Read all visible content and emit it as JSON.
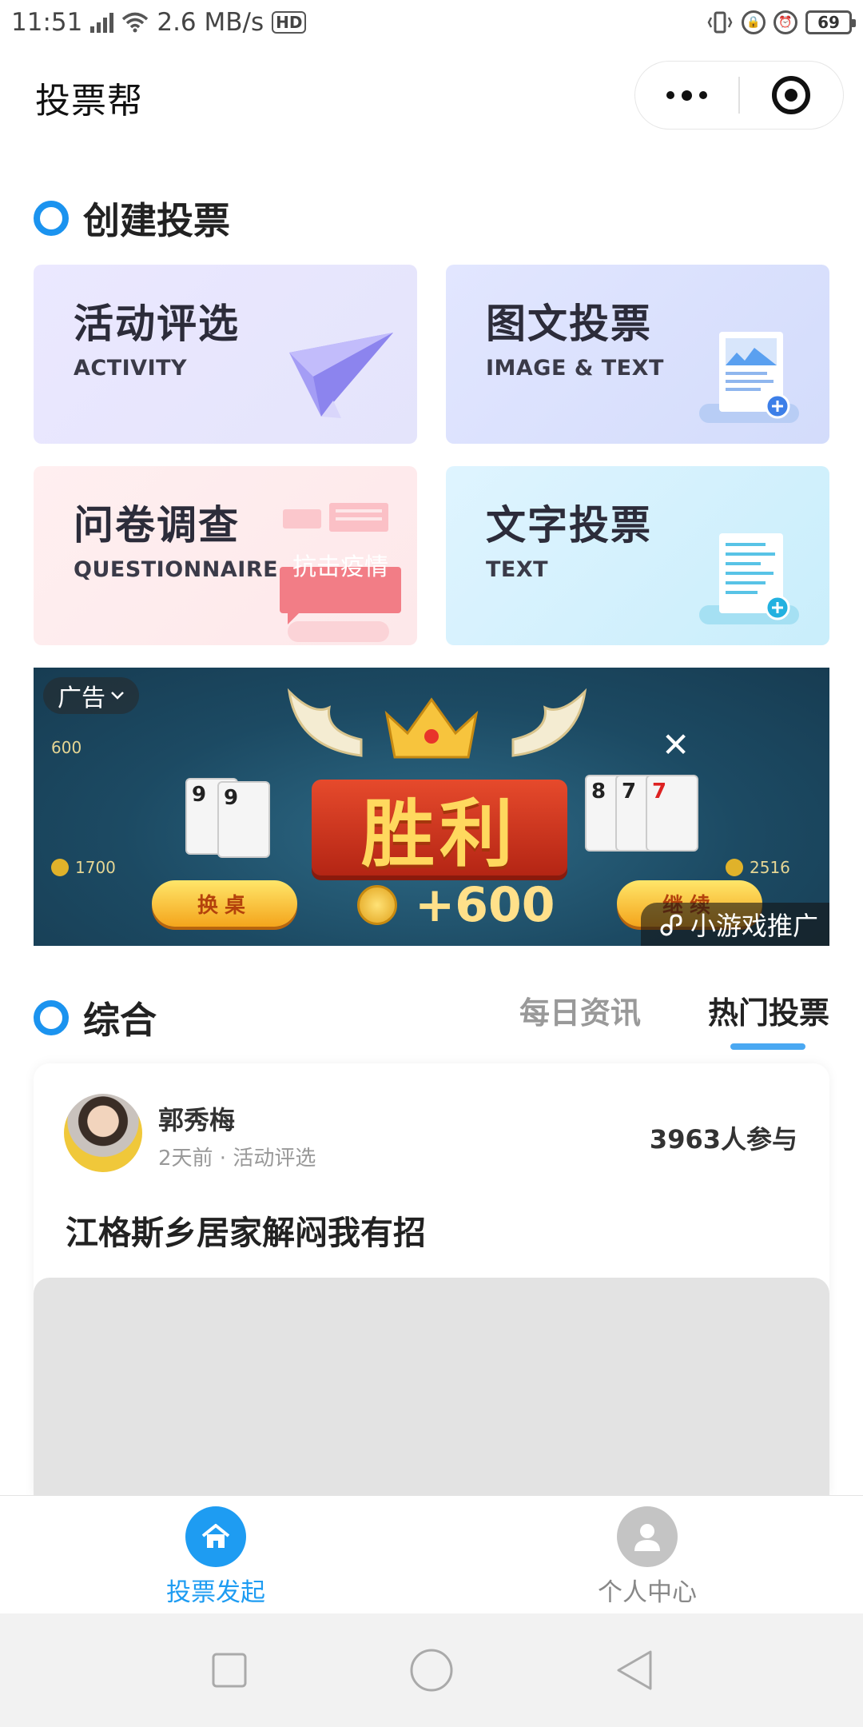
{
  "status_bar": {
    "time": "11:51",
    "network": "4G",
    "speed": "2.6 MB/s",
    "hd": "HD",
    "battery": "69"
  },
  "header": {
    "title": "投票帮",
    "more_icon": "more-dots-icon",
    "close_icon": "target-close-icon"
  },
  "create_section": {
    "title": "创建投票",
    "cards": [
      {
        "title": "活动评选",
        "subtitle": "ACTIVITY",
        "icon": "paper-plane-icon"
      },
      {
        "title": "图文投票",
        "subtitle": "IMAGE & TEXT",
        "icon": "image-document-icon"
      },
      {
        "title": "问卷调查",
        "subtitle": "QUESTIONNAIRE",
        "icon": "chat-bubble-icon",
        "badge": "抗击疫情"
      },
      {
        "title": "文字投票",
        "subtitle": "TEXT",
        "icon": "text-document-icon"
      }
    ]
  },
  "ad": {
    "tag": "广告",
    "banner_title": "胜利",
    "reward": "+600",
    "left_button": "换桌",
    "right_button": "继续",
    "promo_label": "小游戏推广",
    "score_left": "1700",
    "score_right": "2516",
    "score_top": "600"
  },
  "feed_section": {
    "title": "综合",
    "tabs": [
      {
        "label": "每日资讯",
        "active": false
      },
      {
        "label": "热门投票",
        "active": true
      }
    ]
  },
  "vote_item": {
    "author": "郭秀梅",
    "meta": "2天前 · 活动评选",
    "participants": "3963人参与",
    "title": "江格斯乡居家解闷我有招"
  },
  "tabbar": [
    {
      "label": "投票发起",
      "icon": "home-icon",
      "active": true
    },
    {
      "label": "个人中心",
      "icon": "user-icon",
      "active": false
    }
  ],
  "colors": {
    "accent": "#1e9cf2",
    "ring": "#1b93ef",
    "tab_underline": "#4aa8f2"
  }
}
